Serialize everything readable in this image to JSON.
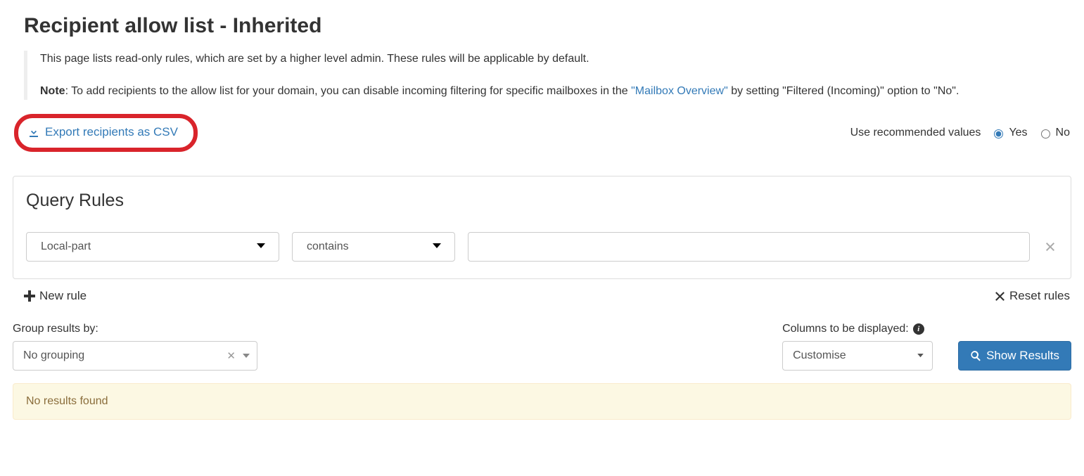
{
  "page": {
    "title": "Recipient allow list - Inherited",
    "intro_line": "This page lists read-only rules, which are set by a higher level admin. These rules will be applicable by default.",
    "note_label": "Note",
    "note_before_link": ": To add recipients to the allow list for your domain, you can disable incoming filtering for specific mailboxes in the ",
    "note_link_text": "\"Mailbox Overview\"",
    "note_after_link": " by setting \"Filtered (Incoming)\" option to \"No\"."
  },
  "actions": {
    "export_label": "Export recipients as CSV",
    "recommended_label": "Use recommended values",
    "yes": "Yes",
    "no": "No",
    "recommended_selected": "yes"
  },
  "query": {
    "panel_title": "Query Rules",
    "field_value": "Local-part",
    "operator_value": "contains",
    "text_value": "",
    "new_rule": "New rule",
    "reset_rules": "Reset rules"
  },
  "lower": {
    "group_label": "Group results by:",
    "group_value": "No grouping",
    "columns_label": "Columns to be displayed:",
    "customise": "Customise",
    "show_results": "Show Results"
  },
  "results": {
    "empty": "No results found"
  }
}
